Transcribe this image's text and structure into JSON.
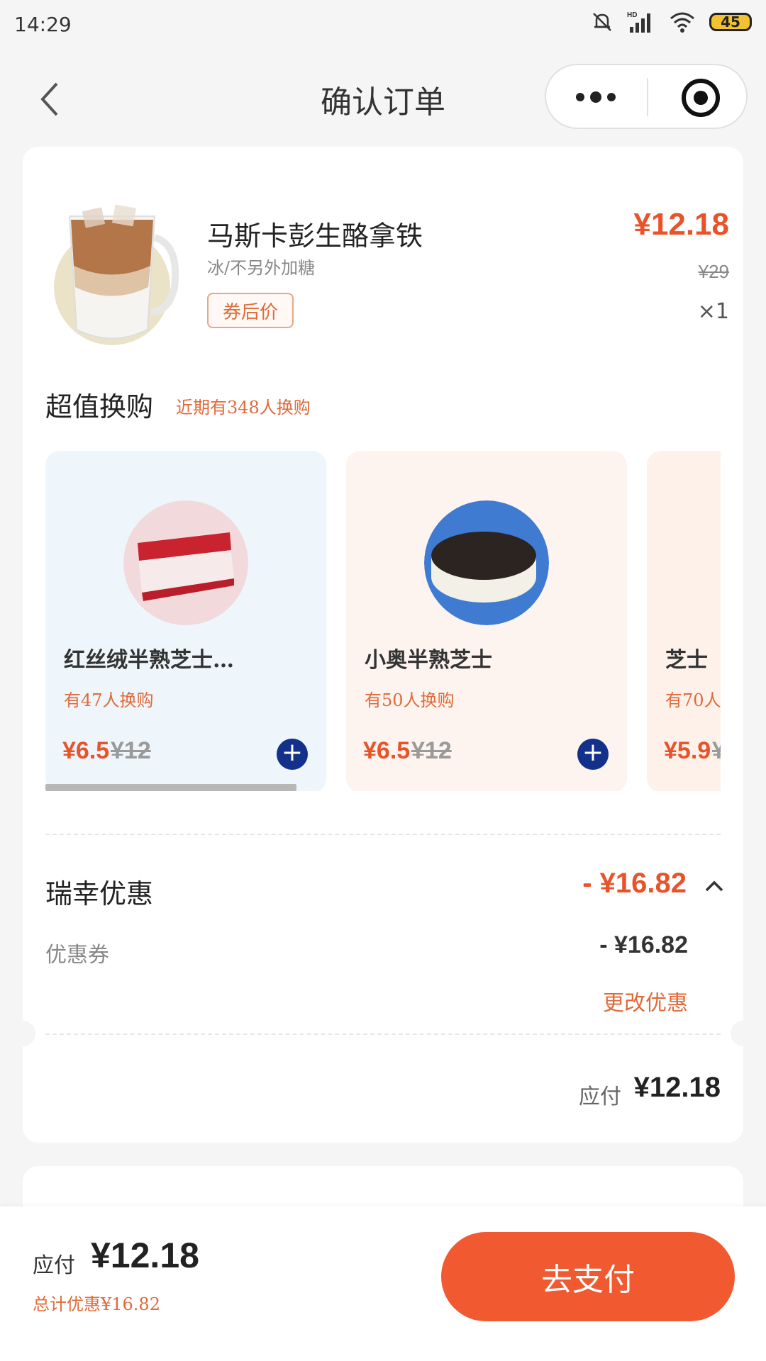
{
  "status": {
    "time": "14:29",
    "battery": "45",
    "network": "HD"
  },
  "header": {
    "title": "确认订单"
  },
  "product": {
    "name": "马斯卡彭生酪拿铁",
    "spec": "冰/不另外加糖",
    "tag": "券后价",
    "price": "¥12.18",
    "original_price": "¥29",
    "quantity": "×1"
  },
  "upsell": {
    "title": "超值换购",
    "note": "近期有348人换购",
    "items": [
      {
        "name": "红丝绒半熟芝士…",
        "count": "有47人换购",
        "price": "¥6.5",
        "original": "¥12",
        "bg": "#eef6fb"
      },
      {
        "name": "小奥半熟芝士",
        "count": "有50人换购",
        "price": "¥6.5",
        "original": "¥12",
        "bg": "#fdf4ef"
      },
      {
        "name": "芝士",
        "count": "有70人",
        "price": "¥5.9",
        "original": "¥",
        "bg": "#fdf1ea"
      }
    ]
  },
  "discount": {
    "title": "瑞幸优惠",
    "total": "- ¥16.82",
    "coupon_label": "优惠券",
    "coupon_value": "- ¥16.82",
    "change_label": "更改优惠"
  },
  "payable": {
    "label": "应付",
    "value": "¥12.18"
  },
  "bottom_bar": {
    "label": "应付",
    "value": "¥12.18",
    "savings": "总计优惠¥16.82",
    "button": "去支付"
  },
  "colors": {
    "accent": "#e8532a",
    "button": "#f15a31",
    "add_button": "#13318a"
  }
}
